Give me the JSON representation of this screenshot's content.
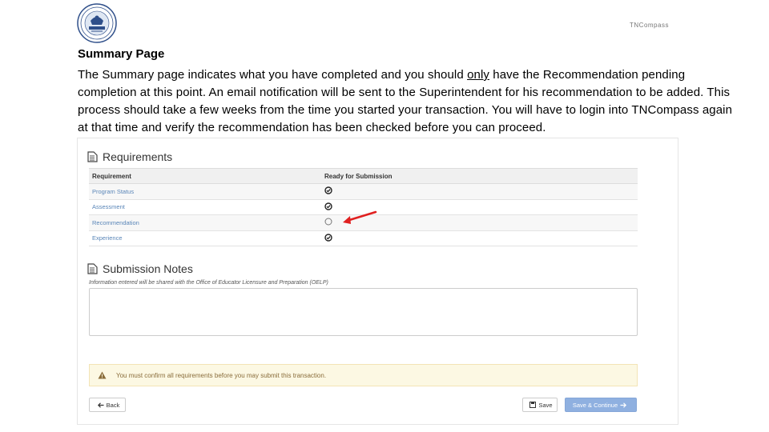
{
  "header": {
    "brand": "TNCompass"
  },
  "slide": {
    "title": "Summary Page",
    "body_before": "The Summary page indicates what you have completed and you should ",
    "body_emphasis": "only",
    "body_after": " have the Recommendation pending completion at this point.  An email notification will be sent to the Superintendent for his recommendation to be added. This process should take a few weeks from the time you started your transaction.  You will have to login into TNCompass again at that time and verify the recommendation has been checked before you can proceed."
  },
  "requirements": {
    "title": "Requirements",
    "col_requirement": "Requirement",
    "col_ready": "Ready for Submission",
    "rows": [
      {
        "name": "Program Status",
        "complete": true
      },
      {
        "name": "Assessment",
        "complete": true
      },
      {
        "name": "Recommendation",
        "complete": false
      },
      {
        "name": "Experience",
        "complete": true
      }
    ]
  },
  "notes": {
    "title": "Submission Notes",
    "hint": "Information entered will be shared with the Office of Educator Licensure and Preparation (OELP)",
    "value": ""
  },
  "alert": {
    "message": "You must confirm all requirements before you may submit this transaction."
  },
  "actions": {
    "back": "Back",
    "save": "Save",
    "continue": "Save & Continue"
  },
  "colors": {
    "link": "#5a86b8",
    "primary": "#8fb0e0",
    "warning_bg": "#fcf8e3",
    "arrow": "#e02020"
  },
  "icons": {
    "seal": "tennessee-seal-icon",
    "complete": "check-circle-icon",
    "pending": "empty-circle-icon",
    "section": "document-icon",
    "warning": "warning-triangle-icon",
    "back": "arrow-left-icon",
    "save": "floppy-disk-icon",
    "continue": "arrow-right-icon"
  }
}
